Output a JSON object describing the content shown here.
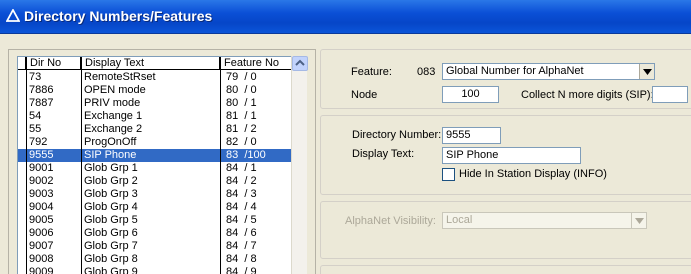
{
  "window": {
    "title": "Directory Numbers/Features"
  },
  "list": {
    "columns": [
      "Dir No",
      "Display Text",
      "Feature No"
    ],
    "rows": [
      {
        "dir": "73",
        "text": "RemoteStRset",
        "feature": "79  / 0"
      },
      {
        "dir": "7886",
        "text": "OPEN mode",
        "feature": "80  / 0"
      },
      {
        "dir": "7887",
        "text": "PRIV mode",
        "feature": "80  / 1"
      },
      {
        "dir": "54",
        "text": "Exchange 1",
        "feature": "81  / 1"
      },
      {
        "dir": "55",
        "text": "Exchange 2",
        "feature": "81  / 2"
      },
      {
        "dir": "792",
        "text": "ProgOnOff",
        "feature": "82  / 0"
      },
      {
        "dir": "9555",
        "text": "SIP Phone",
        "feature": "83  /100",
        "selected": true
      },
      {
        "dir": "9001",
        "text": "Glob Grp 1",
        "feature": "84  / 1"
      },
      {
        "dir": "9002",
        "text": "Glob Grp 2",
        "feature": "84  / 2"
      },
      {
        "dir": "9003",
        "text": "Glob Grp 3",
        "feature": "84  / 3"
      },
      {
        "dir": "9004",
        "text": "Glob Grp 4",
        "feature": "84  / 4"
      },
      {
        "dir": "9005",
        "text": "Glob Grp 5",
        "feature": "84  / 5"
      },
      {
        "dir": "9006",
        "text": "Glob Grp 6",
        "feature": "84  / 6"
      },
      {
        "dir": "9007",
        "text": "Glob Grp 7",
        "feature": "84  / 7"
      },
      {
        "dir": "9008",
        "text": "Glob Grp 8",
        "feature": "84  / 8"
      },
      {
        "dir": "9009",
        "text": "Glob Grp 9",
        "feature": "84  / 9"
      }
    ]
  },
  "feature": {
    "label": "Feature:",
    "code": "083",
    "selected": "Global Number for AlphaNet",
    "node_label": "Node",
    "node_value": "100",
    "collect_label": "Collect N more digits (SIP):",
    "collect_value": ""
  },
  "directory": {
    "number_label": "Directory Number:",
    "number_value": "9555",
    "display_label": "Display Text:",
    "display_value": "SIP Phone",
    "hide_label": "Hide In Station Display (INFO)",
    "hide_checked": false
  },
  "alphanet": {
    "label": "AlphaNet Visibility:",
    "value": "Local"
  },
  "colors": {
    "title_bar": "#0a4fd6",
    "selection": "#316ac5",
    "background": "#ece9d8"
  }
}
